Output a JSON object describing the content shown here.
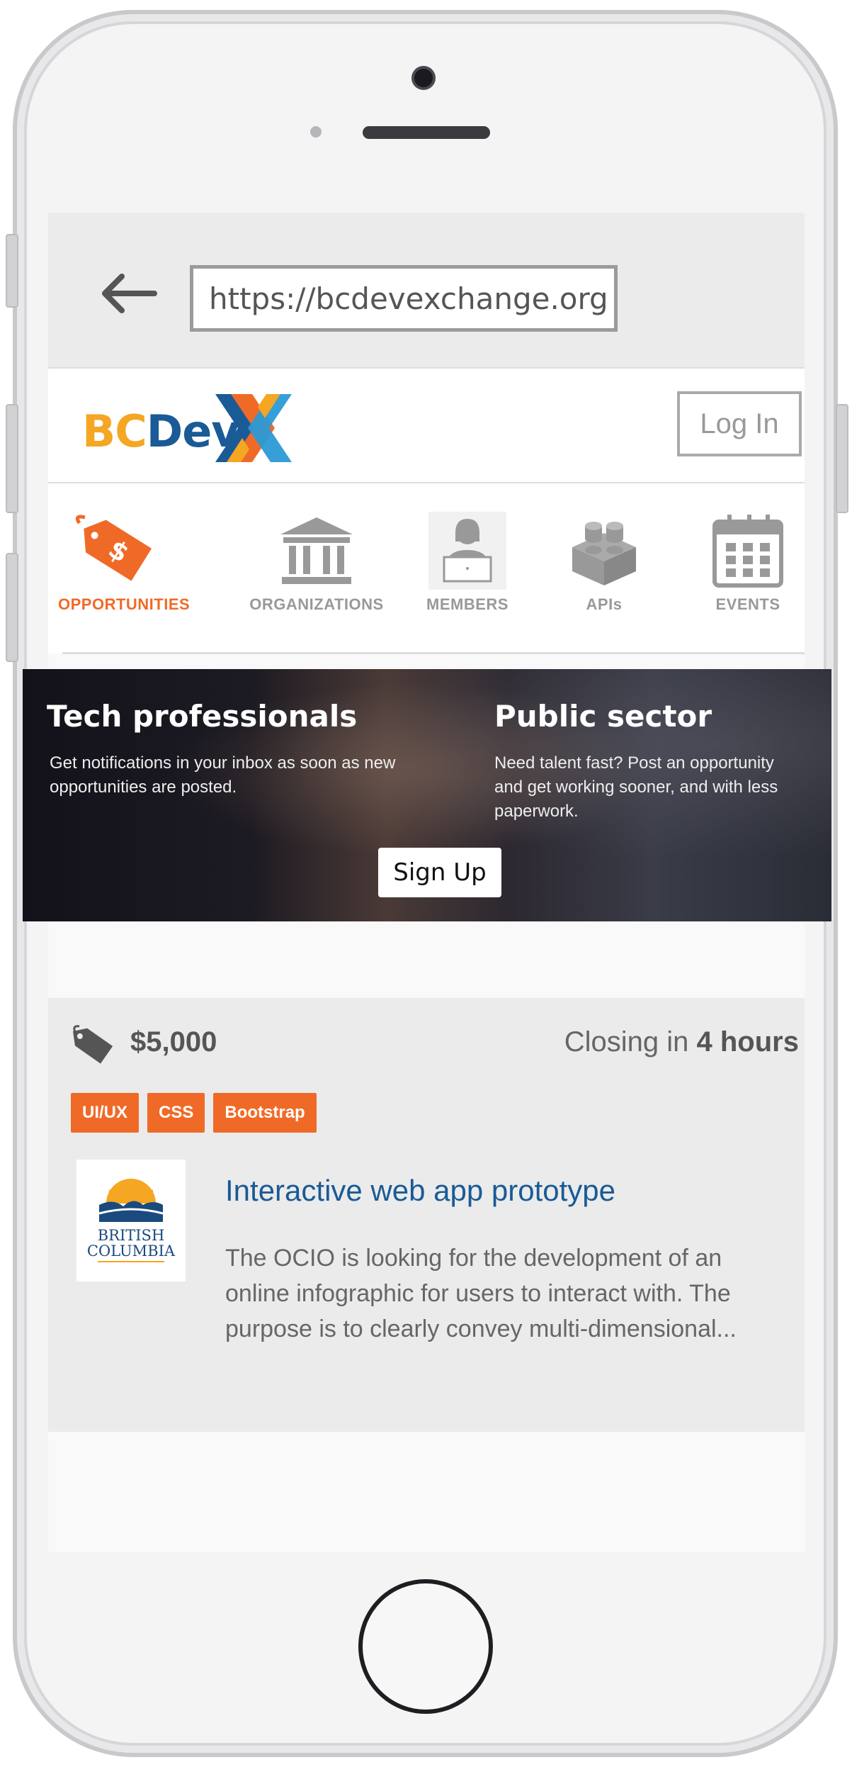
{
  "browser": {
    "url": "https://bcdevexchange.org"
  },
  "header": {
    "logo_bc": "BC",
    "logo_dev": "Dev",
    "login_label": "Log In"
  },
  "nav": {
    "items": [
      {
        "label": "OPPORTUNITIES",
        "icon": "price-tag-icon",
        "active": true
      },
      {
        "label": "ORGANIZATIONS",
        "icon": "building-icon",
        "active": false
      },
      {
        "label": "MEMBERS",
        "icon": "person-laptop-icon",
        "active": false
      },
      {
        "label": "APIs",
        "icon": "lego-block-icon",
        "active": false
      },
      {
        "label": "EVENTS",
        "icon": "calendar-icon",
        "active": false
      }
    ]
  },
  "hero": {
    "left_title": "Tech professionals",
    "left_text": "Get notifications in your inbox as soon as new opportunities are posted.",
    "right_title": "Public sector",
    "right_text": "Need talent fast? Post an opportunity and get working sooner, and with less paperwork.",
    "signup_label": "Sign Up"
  },
  "opportunity": {
    "price": "$5,000",
    "closing_prefix": "Closing in",
    "closing_value": "4 hours",
    "tags": [
      "UI/UX",
      "CSS",
      "Bootstrap"
    ],
    "org_logo_line1": "BRITISH",
    "org_logo_line2": "COLUMBIA",
    "title": "Interactive web app prototype",
    "description": "The OCIO is looking for the development of an online infographic for users to interact with. The purpose is to clearly convey multi-dimensional..."
  },
  "colors": {
    "accent_orange": "#f06a27",
    "link_blue": "#1a5a96",
    "nav_inactive": "#999999"
  }
}
